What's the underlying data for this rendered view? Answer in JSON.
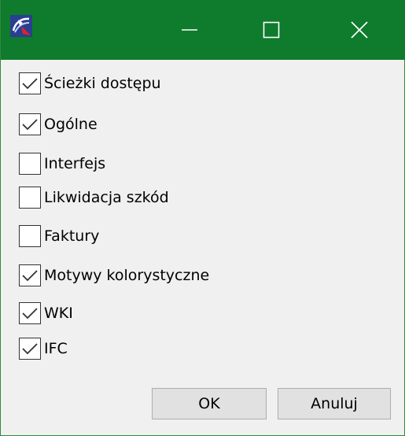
{
  "window": {
    "title": "",
    "controls": {
      "minimize": "minimize-icon",
      "maximize": "maximize-icon",
      "close": "close-icon"
    },
    "accent_color": "#0f7b2d"
  },
  "options": [
    {
      "label": "Ścieżki dostępu",
      "checked": true
    },
    {
      "label": "Ogólne",
      "checked": true
    },
    {
      "label": "Interfejs",
      "checked": false
    },
    {
      "label": "Likwidacja szkód",
      "checked": false
    },
    {
      "label": "Faktury",
      "checked": false
    },
    {
      "label": "Motywy kolorystyczne",
      "checked": true
    },
    {
      "label": "WKI",
      "checked": true
    },
    {
      "label": "IFC",
      "checked": true
    }
  ],
  "buttons": {
    "ok_label": "OK",
    "cancel_label": "Anuluj"
  }
}
